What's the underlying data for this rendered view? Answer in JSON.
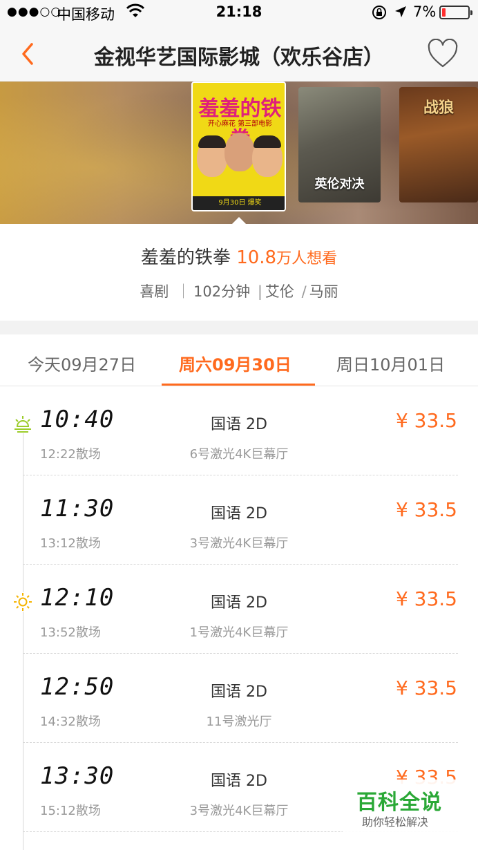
{
  "status_bar": {
    "signal": "●●●○○",
    "carrier": "中国移动",
    "time": "21:18",
    "battery_percent": "7%",
    "battery_level": 0.07
  },
  "nav": {
    "title": "金视华艺国际影城（欢乐谷店）"
  },
  "banner": {
    "poster1_title": "羞羞的铁拳",
    "poster1_sub": "开心麻花 第三部电影",
    "poster1_date": "9月30日 爆笑",
    "poster2_title": "英伦对决",
    "poster3_title": "战狼"
  },
  "movie": {
    "name": "羞羞的铁拳",
    "heat_number": "10.8",
    "heat_unit": "万人想看",
    "genre": "喜剧",
    "duration": "102分钟",
    "actor1": "艾伦",
    "actor2": "马丽"
  },
  "dates": {
    "tab1": "今天09月27日",
    "tab2": "周六09月30日",
    "tab3": "周日10月01日"
  },
  "showtimes": [
    {
      "start": "10:40",
      "end": "12:22散场",
      "lang": "国语 2D",
      "hall": "6号激光4K巨幕厅",
      "price": "¥ 33.5",
      "icon": "sunrise-icon"
    },
    {
      "start": "11:30",
      "end": "13:12散场",
      "lang": "国语 2D",
      "hall": "3号激光4K巨幕厅",
      "price": "¥ 33.5",
      "icon": ""
    },
    {
      "start": "12:10",
      "end": "13:52散场",
      "lang": "国语 2D",
      "hall": "1号激光4K巨幕厅",
      "price": "¥ 33.5",
      "icon": "sun-icon"
    },
    {
      "start": "12:50",
      "end": "14:32散场",
      "lang": "国语 2D",
      "hall": "11号激光厅",
      "price": "¥ 33.5",
      "icon": ""
    },
    {
      "start": "13:30",
      "end": "15:12散场",
      "lang": "国语 2D",
      "hall": "3号激光4K巨幕厅",
      "price": "¥ 33.5",
      "icon": ""
    }
  ],
  "watermark": {
    "title": "百科全说",
    "subtitle": "助你轻松解决"
  },
  "colors": {
    "accent": "#ff6a1e",
    "watermark_green": "#2aa836"
  }
}
